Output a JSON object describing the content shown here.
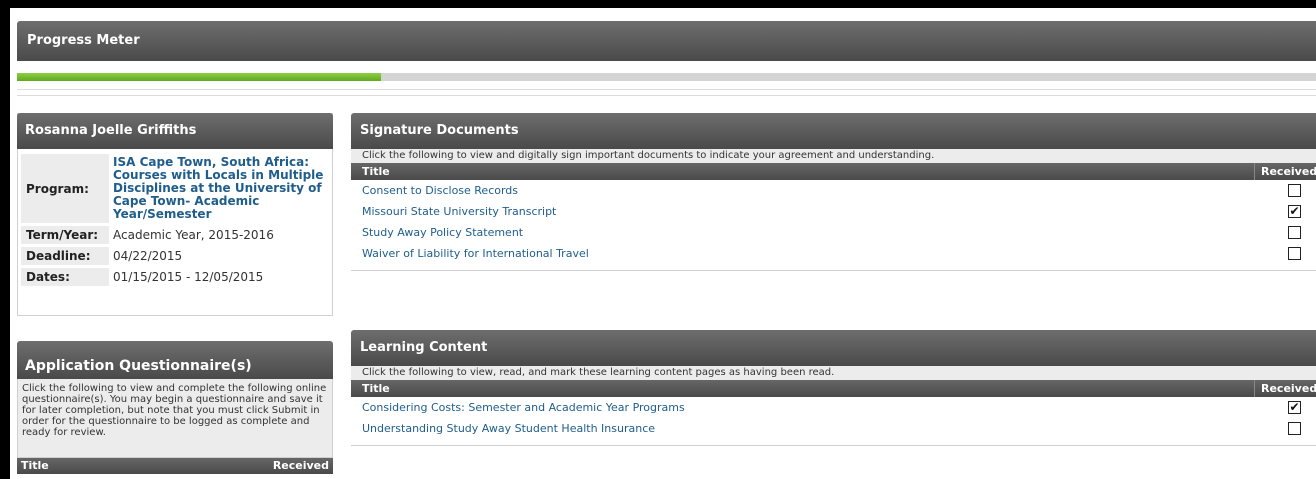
{
  "progress": {
    "title": "Progress Meter",
    "fraction": 0.28
  },
  "student": {
    "name": "Rosanna Joelle Griffiths",
    "fields": [
      {
        "label": "Program:",
        "value": "ISA Cape Town, South Africa: Courses with Locals in Multiple Disciplines at the University of Cape Town- Academic Year/Semester"
      },
      {
        "label": "Term/Year:",
        "value": "Academic Year, 2015-2016"
      },
      {
        "label": "Deadline:",
        "value": "04/22/2015"
      },
      {
        "label": "Dates:",
        "value": "01/15/2015 - 12/05/2015"
      }
    ]
  },
  "questionnaire": {
    "title": "Application Questionnaire(s)",
    "description": "Click the following to view and complete the following online questionnaire(s). You may begin a questionnaire and save it for later completion, but note that you must click Submit in order for the questionnaire to be logged as complete and ready for review.",
    "col_title": "Title",
    "col_received": "Received"
  },
  "signature": {
    "title": "Signature Documents",
    "description": "Click the following to view and digitally sign important documents to indicate your agreement and understanding.",
    "col_title": "Title",
    "col_received": "Received",
    "rows": [
      {
        "title": "Consent to Disclose Records",
        "received": false
      },
      {
        "title": "Missouri State University Transcript",
        "received": true
      },
      {
        "title": "Study Away Policy Statement",
        "received": false
      },
      {
        "title": "Waiver of Liability for International Travel",
        "received": false
      }
    ]
  },
  "learning": {
    "title": "Learning Content",
    "description": "Click the following to view, read, and mark these learning content pages as having been read.",
    "col_title": "Title",
    "col_received": "Received",
    "rows": [
      {
        "title": "Considering Costs: Semester and Academic Year Programs",
        "received": true
      },
      {
        "title": "Understanding Study Away Student Health Insurance",
        "received": false
      }
    ]
  },
  "icons": {
    "check": "checkmark-icon"
  }
}
